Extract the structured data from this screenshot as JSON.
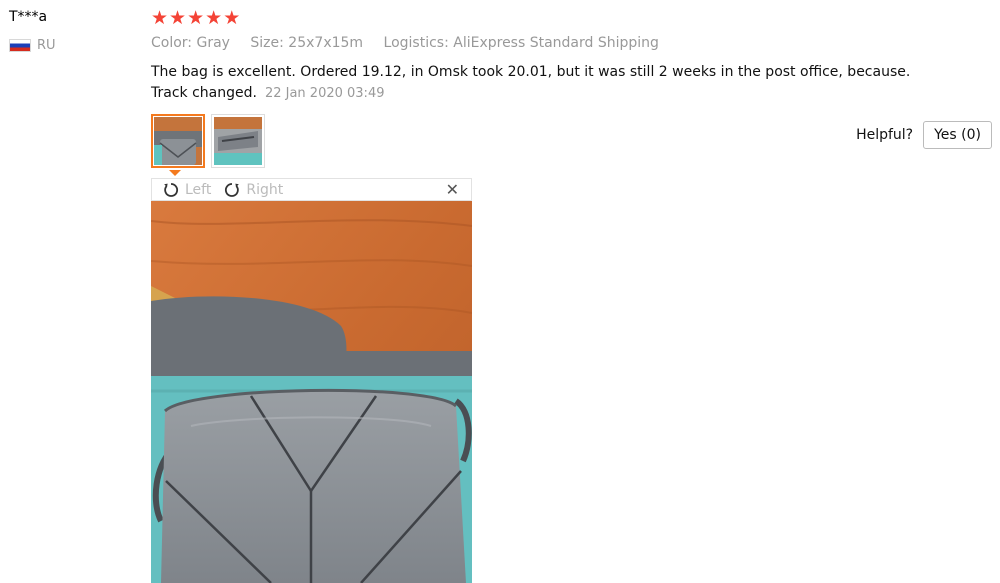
{
  "review": {
    "user": "T***a",
    "country": "RU",
    "flag_icon": "russia-flag-icon",
    "rating": 5,
    "stars": [
      "★",
      "★",
      "★",
      "★",
      "★"
    ],
    "star_color": "#f44336",
    "attributes": {
      "color": "Color: Gray",
      "size": "Size: 25x7x15m",
      "logistics": "Logistics: AliExpress Standard Shipping"
    },
    "text": "The bag is excellent. Ordered 19.12, in Omsk took 20.01, but it was still 2 weeks in the post office, because. Track changed.",
    "date": "22 Jan 2020 03:49",
    "helpful_label": "Helpful?",
    "yes_label": "Yes (0)"
  },
  "viewer": {
    "left_label": "Left",
    "right_label": "Right",
    "close_glyph": "✕",
    "rotate_left_icon": "rotate-left-icon",
    "rotate_right_icon": "rotate-right-icon",
    "active_thumb_color": "#f47a1f"
  }
}
